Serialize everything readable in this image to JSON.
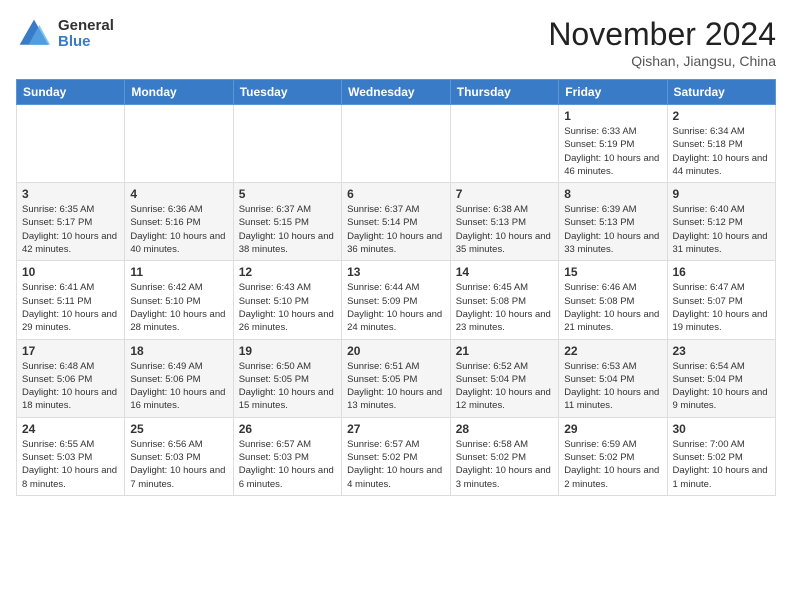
{
  "logo": {
    "general": "General",
    "blue": "Blue"
  },
  "title": "November 2024",
  "location": "Qishan, Jiangsu, China",
  "days_of_week": [
    "Sunday",
    "Monday",
    "Tuesday",
    "Wednesday",
    "Thursday",
    "Friday",
    "Saturday"
  ],
  "weeks": [
    [
      {
        "num": "",
        "info": ""
      },
      {
        "num": "",
        "info": ""
      },
      {
        "num": "",
        "info": ""
      },
      {
        "num": "",
        "info": ""
      },
      {
        "num": "",
        "info": ""
      },
      {
        "num": "1",
        "info": "Sunrise: 6:33 AM\nSunset: 5:19 PM\nDaylight: 10 hours and 46 minutes."
      },
      {
        "num": "2",
        "info": "Sunrise: 6:34 AM\nSunset: 5:18 PM\nDaylight: 10 hours and 44 minutes."
      }
    ],
    [
      {
        "num": "3",
        "info": "Sunrise: 6:35 AM\nSunset: 5:17 PM\nDaylight: 10 hours and 42 minutes."
      },
      {
        "num": "4",
        "info": "Sunrise: 6:36 AM\nSunset: 5:16 PM\nDaylight: 10 hours and 40 minutes."
      },
      {
        "num": "5",
        "info": "Sunrise: 6:37 AM\nSunset: 5:15 PM\nDaylight: 10 hours and 38 minutes."
      },
      {
        "num": "6",
        "info": "Sunrise: 6:37 AM\nSunset: 5:14 PM\nDaylight: 10 hours and 36 minutes."
      },
      {
        "num": "7",
        "info": "Sunrise: 6:38 AM\nSunset: 5:13 PM\nDaylight: 10 hours and 35 minutes."
      },
      {
        "num": "8",
        "info": "Sunrise: 6:39 AM\nSunset: 5:13 PM\nDaylight: 10 hours and 33 minutes."
      },
      {
        "num": "9",
        "info": "Sunrise: 6:40 AM\nSunset: 5:12 PM\nDaylight: 10 hours and 31 minutes."
      }
    ],
    [
      {
        "num": "10",
        "info": "Sunrise: 6:41 AM\nSunset: 5:11 PM\nDaylight: 10 hours and 29 minutes."
      },
      {
        "num": "11",
        "info": "Sunrise: 6:42 AM\nSunset: 5:10 PM\nDaylight: 10 hours and 28 minutes."
      },
      {
        "num": "12",
        "info": "Sunrise: 6:43 AM\nSunset: 5:10 PM\nDaylight: 10 hours and 26 minutes."
      },
      {
        "num": "13",
        "info": "Sunrise: 6:44 AM\nSunset: 5:09 PM\nDaylight: 10 hours and 24 minutes."
      },
      {
        "num": "14",
        "info": "Sunrise: 6:45 AM\nSunset: 5:08 PM\nDaylight: 10 hours and 23 minutes."
      },
      {
        "num": "15",
        "info": "Sunrise: 6:46 AM\nSunset: 5:08 PM\nDaylight: 10 hours and 21 minutes."
      },
      {
        "num": "16",
        "info": "Sunrise: 6:47 AM\nSunset: 5:07 PM\nDaylight: 10 hours and 19 minutes."
      }
    ],
    [
      {
        "num": "17",
        "info": "Sunrise: 6:48 AM\nSunset: 5:06 PM\nDaylight: 10 hours and 18 minutes."
      },
      {
        "num": "18",
        "info": "Sunrise: 6:49 AM\nSunset: 5:06 PM\nDaylight: 10 hours and 16 minutes."
      },
      {
        "num": "19",
        "info": "Sunrise: 6:50 AM\nSunset: 5:05 PM\nDaylight: 10 hours and 15 minutes."
      },
      {
        "num": "20",
        "info": "Sunrise: 6:51 AM\nSunset: 5:05 PM\nDaylight: 10 hours and 13 minutes."
      },
      {
        "num": "21",
        "info": "Sunrise: 6:52 AM\nSunset: 5:04 PM\nDaylight: 10 hours and 12 minutes."
      },
      {
        "num": "22",
        "info": "Sunrise: 6:53 AM\nSunset: 5:04 PM\nDaylight: 10 hours and 11 minutes."
      },
      {
        "num": "23",
        "info": "Sunrise: 6:54 AM\nSunset: 5:04 PM\nDaylight: 10 hours and 9 minutes."
      }
    ],
    [
      {
        "num": "24",
        "info": "Sunrise: 6:55 AM\nSunset: 5:03 PM\nDaylight: 10 hours and 8 minutes."
      },
      {
        "num": "25",
        "info": "Sunrise: 6:56 AM\nSunset: 5:03 PM\nDaylight: 10 hours and 7 minutes."
      },
      {
        "num": "26",
        "info": "Sunrise: 6:57 AM\nSunset: 5:03 PM\nDaylight: 10 hours and 6 minutes."
      },
      {
        "num": "27",
        "info": "Sunrise: 6:57 AM\nSunset: 5:02 PM\nDaylight: 10 hours and 4 minutes."
      },
      {
        "num": "28",
        "info": "Sunrise: 6:58 AM\nSunset: 5:02 PM\nDaylight: 10 hours and 3 minutes."
      },
      {
        "num": "29",
        "info": "Sunrise: 6:59 AM\nSunset: 5:02 PM\nDaylight: 10 hours and 2 minutes."
      },
      {
        "num": "30",
        "info": "Sunrise: 7:00 AM\nSunset: 5:02 PM\nDaylight: 10 hours and 1 minute."
      }
    ]
  ]
}
